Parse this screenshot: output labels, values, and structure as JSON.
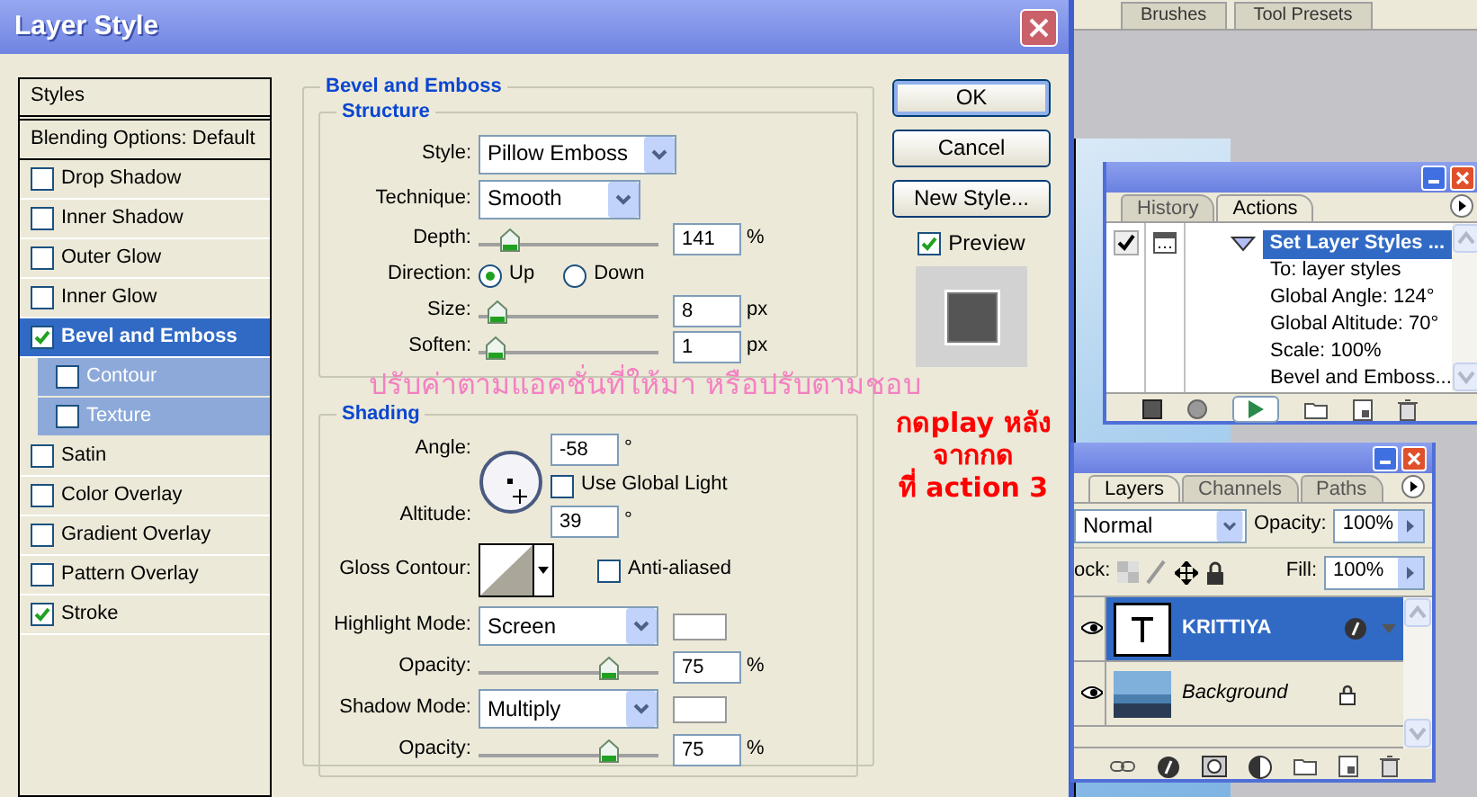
{
  "top_tabs": [
    "Brushes",
    "Tool Presets"
  ],
  "dialog": {
    "title": "Layer Style",
    "styles_header": "Styles",
    "blending_options": "Blending Options: Default",
    "effects": [
      {
        "label": "Drop Shadow",
        "checked": false,
        "selected": false
      },
      {
        "label": "Inner Shadow",
        "checked": false,
        "selected": false
      },
      {
        "label": "Outer Glow",
        "checked": false,
        "selected": false
      },
      {
        "label": "Inner Glow",
        "checked": false,
        "selected": false
      },
      {
        "label": "Bevel and Emboss",
        "checked": true,
        "selected": true,
        "children": [
          {
            "label": "Contour",
            "checked": false,
            "selected": false
          },
          {
            "label": "Texture",
            "checked": false,
            "selected": false
          }
        ]
      },
      {
        "label": "Satin",
        "checked": false,
        "selected": false
      },
      {
        "label": "Color Overlay",
        "checked": false,
        "selected": false
      },
      {
        "label": "Gradient Overlay",
        "checked": false,
        "selected": false
      },
      {
        "label": "Pattern Overlay",
        "checked": false,
        "selected": false
      },
      {
        "label": "Stroke",
        "checked": true,
        "selected": false
      }
    ],
    "bevel_and_emboss": {
      "title": "Bevel and Emboss",
      "structure": {
        "title": "Structure",
        "style": {
          "label": "Style:",
          "value": "Pillow Emboss"
        },
        "technique": {
          "label": "Technique:",
          "value": "Smooth"
        },
        "depth": {
          "label": "Depth:",
          "level": 0.14,
          "value": "141",
          "unit": "%"
        },
        "direction": {
          "label": "Direction:",
          "options": [
            {
              "label": "Up",
              "selected": true
            },
            {
              "label": "Down",
              "selected": false
            }
          ]
        },
        "size": {
          "label": "Size:",
          "level": 0.06,
          "value": "8",
          "unit": "px"
        },
        "soften": {
          "label": "Soften:",
          "level": 0.04,
          "value": "1",
          "unit": "px"
        }
      },
      "shading": {
        "title": "Shading",
        "angle": {
          "label": "Angle:",
          "value": "-58",
          "unit": "°"
        },
        "use_global_light": {
          "label": "Use Global Light",
          "checked": false
        },
        "altitude": {
          "label": "Altitude:",
          "value": "39",
          "unit": "°"
        },
        "gloss_contour": {
          "label": "Gloss Contour:"
        },
        "anti_aliased": {
          "label": "Anti-aliased",
          "checked": false
        },
        "highlight_mode": {
          "label": "Highlight Mode:",
          "value": "Screen"
        },
        "highlight_opacity": {
          "label": "Opacity:",
          "level": 0.75,
          "value": "75",
          "unit": "%"
        },
        "shadow_mode": {
          "label": "Shadow Mode:",
          "value": "Multiply"
        },
        "shadow_opacity": {
          "label": "Opacity:",
          "level": 0.75,
          "value": "75",
          "unit": "%"
        }
      }
    },
    "buttons": [
      {
        "label": "OK",
        "default": true
      },
      {
        "label": "Cancel",
        "default": false
      },
      {
        "label": "New Style...",
        "default": false
      }
    ],
    "preview": {
      "label": "Preview",
      "checked": true
    }
  },
  "annotations": {
    "instruction": "ปรับค่าตามแอคชั่นที่ให้มา หรือปรับตามชอบ",
    "hint": [
      "กดplay หลังจากกด",
      "ที่ action 3"
    ]
  },
  "actions_panel": {
    "tabs": [
      {
        "label": "History",
        "selected": false
      },
      {
        "label": "Actions",
        "selected": true
      }
    ],
    "action": {
      "label": "Set Layer Styles ...",
      "selected": true,
      "checked": true,
      "expanded": true,
      "children": [
        {
          "label": "To: layer styles"
        },
        {
          "label": "Global Angle: 124°"
        },
        {
          "label": "Global Altitude: 70°"
        },
        {
          "label": "Scale: 100%"
        },
        {
          "label": "Bevel and Emboss..."
        }
      ]
    }
  },
  "layers_panel": {
    "tabs": [
      {
        "label": "Layers",
        "selected": true
      },
      {
        "label": "Channels",
        "selected": false
      },
      {
        "label": "Paths",
        "selected": false
      }
    ],
    "blend_mode": "Normal",
    "opacity": {
      "label": "Opacity:",
      "value": "100%"
    },
    "lock_label": "ock:",
    "fill": {
      "label": "Fill:",
      "value": "100%"
    },
    "layers": [
      {
        "name": "KRITTIYA",
        "kind": "text",
        "selected": true,
        "visible": true,
        "has_style": true,
        "locked": false
      },
      {
        "name": "Background",
        "kind": "image",
        "selected": false,
        "visible": true,
        "has_style": false,
        "locked": true
      }
    ]
  }
}
